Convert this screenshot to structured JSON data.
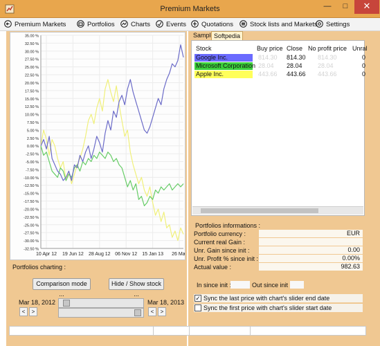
{
  "window": {
    "title": "Premium Markets",
    "min_glyph": "—",
    "max_glyph": "□",
    "close_glyph": "✕"
  },
  "menu": [
    {
      "label": "Premium Markets",
      "icon": "back-arrow-icon"
    },
    {
      "label": "Portfolios",
      "icon": "portfolio-icon"
    },
    {
      "label": "Charts",
      "icon": "chart-icon"
    },
    {
      "label": "Events",
      "icon": "events-icon"
    },
    {
      "label": "Quotations",
      "icon": "quotations-icon"
    },
    {
      "label": "Stock lists and Markets",
      "icon": "stocklist-icon"
    },
    {
      "label": "Settings",
      "icon": "settings-icon"
    }
  ],
  "chart_data": {
    "type": "line",
    "x_tick_labels": [
      "10 Apr 12",
      "19 Jun 12",
      "28 Aug 12",
      "06 Nov 12",
      "15 Jan 13",
      "26 Mar"
    ],
    "y_tick_labels": [
      "35.00 %",
      "32.50 %",
      "30.00 %",
      "27.50 %",
      "25.00 %",
      "22.50 %",
      "20.00 %",
      "17.50 %",
      "15.00 %",
      "12.50 %",
      "10.00 %",
      "7.50 %",
      "5.00 %",
      "2.50 %",
      "0.00 %",
      "-2.50 %",
      "-5.00 %",
      "-7.50 %",
      "-10.00 %",
      "-12.50 %",
      "-15.00 %",
      "-17.50 %",
      "-20.00 %",
      "-22.50 %",
      "-25.00 %",
      "-27.50 %",
      "-30.00 %",
      "-32.50 %"
    ],
    "ylim": [
      -32.5,
      35
    ],
    "x_index_range": [
      0,
      51
    ],
    "grid": true,
    "series": [
      {
        "stock": "Google Inc.",
        "color": "#6b6bc8",
        "values": [
          0,
          2,
          -1,
          3,
          -4,
          -6,
          -8,
          -9,
          -11,
          -10,
          -8,
          -11,
          -6,
          -7,
          -3,
          -5,
          -2,
          0,
          -4,
          -1,
          3,
          1,
          -2,
          4,
          8,
          5,
          11,
          9,
          14,
          16,
          13,
          18,
          21,
          17,
          14,
          11,
          8,
          5,
          4,
          6,
          9,
          12,
          15,
          13,
          18,
          21,
          23,
          26,
          25,
          27,
          32,
          28
        ]
      },
      {
        "stock": "Microsoft Corporation",
        "color": "#66cc66",
        "values": [
          0,
          -3,
          -2,
          -5,
          -8,
          -9,
          -10,
          -7,
          -8,
          -11,
          -9,
          -10,
          -7,
          -6,
          -8,
          -5,
          -6,
          -4,
          -5,
          -3,
          -4,
          -2,
          -3,
          -4,
          -2,
          -3,
          -5,
          -4,
          -6,
          -7,
          -10,
          -13,
          -11,
          -14,
          -12,
          -17,
          -16,
          -19,
          -18,
          -16,
          -17,
          -14,
          -15,
          -13,
          -14,
          -13,
          -12,
          -14,
          -13,
          -12,
          -13,
          -12
        ]
      },
      {
        "stock": "Apple Inc.",
        "color": "#f0f07a",
        "values": [
          0,
          5,
          2,
          -3,
          2,
          0,
          -4,
          -7,
          -5,
          -11,
          -8,
          -12,
          -9,
          -6,
          -4,
          -1,
          3,
          8,
          10,
          7,
          12,
          15,
          11,
          18,
          21,
          17,
          14,
          19,
          13,
          8,
          3,
          5,
          -2,
          -6,
          -9,
          -12,
          -10,
          -14,
          -16,
          -13,
          -18,
          -22,
          -20,
          -24,
          -21,
          -26,
          -25,
          -29,
          -27,
          -30,
          -26,
          -28
        ]
      }
    ]
  },
  "charting": {
    "label": "Portfolios charting :",
    "comparison_button": "Comparison mode ...",
    "hide_show_button": "Hide / Show stock ...",
    "start_date": "Mar 18, 2012",
    "end_date": "Mar 18, 2013",
    "left_arrow": "<",
    "right_arrow": ">",
    "slider_start_fraction": 0.05,
    "slider_end_fraction": 0.97
  },
  "tabs": [
    {
      "label": "Sample",
      "active": false
    },
    {
      "label": "Softpedia",
      "active": true
    }
  ],
  "stock_table": {
    "headers": [
      "Stock",
      "Buy price",
      "Close",
      "No profit price",
      "Unral"
    ],
    "rows": [
      {
        "name": "Google Inc.",
        "color": "#6b6bff",
        "buy": "814.30",
        "close": "814.30",
        "no_profit": "814.30",
        "unreal": "0"
      },
      {
        "name": "Microsoft Corporation",
        "color": "#3cd03c",
        "buy": "28.04",
        "close": "28.04",
        "no_profit": "28.04",
        "unreal": "0"
      },
      {
        "name": "Apple Inc.",
        "color": "#ffff5a",
        "buy": "443.66",
        "close": "443.66",
        "no_profit": "443.66",
        "unreal": "0"
      }
    ]
  },
  "portfolio_info": {
    "title": "Portfolios informations :",
    "rows": [
      {
        "label": "Portfolio currency :",
        "value": "EUR"
      },
      {
        "label": "Current real Gain :",
        "value": ""
      },
      {
        "label": "Unr. Gain since init :",
        "value": "0.00"
      },
      {
        "label": "Unr. Profit %  since init :",
        "value": "0.00%"
      },
      {
        "label": "Actual value :",
        "value": "982.63"
      }
    ],
    "in_since_init_label": "In since init :",
    "out_since_init_label": "Out since init :",
    "sync_last_label": "Sync the last price with chart's slider end date",
    "sync_last_checked": true,
    "sync_first_label": "Sync the first price with chart's slider start date",
    "sync_first_checked": false,
    "check_glyph": "✓"
  }
}
